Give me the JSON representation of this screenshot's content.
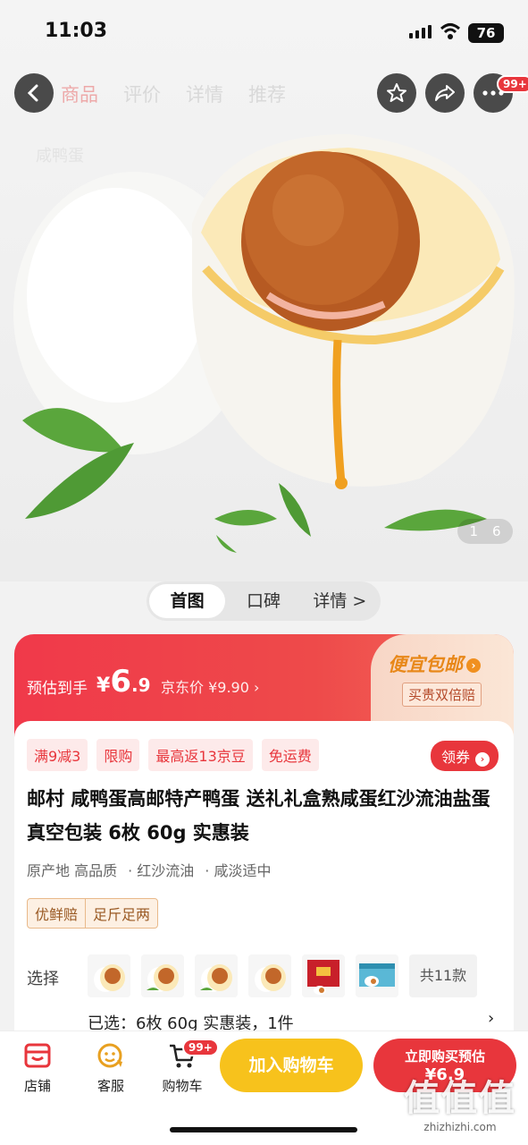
{
  "status": {
    "time": "11:03",
    "battery": "76"
  },
  "nav": {
    "tabs": [
      "商品",
      "评价",
      "详情",
      "推荐"
    ],
    "ghost_search": "咸鸭蛋",
    "more_badge": "99+"
  },
  "gallery": {
    "current": "1",
    "total": "6"
  },
  "segments": [
    "首图",
    "口碑",
    "详情 >"
  ],
  "price": {
    "estimate_label": "预估到手",
    "currency": "¥",
    "integer": "6",
    "decimal": ".9",
    "jd_price": "京东价 ¥9.90",
    "slogan": "便宜包邮",
    "guarantee": "买贵双倍赔"
  },
  "promo_tags": [
    "满9减3",
    "限购",
    "最高返13京豆",
    "免运费"
  ],
  "coupon_label": "领券",
  "product": {
    "title": "邮村 咸鸭蛋高邮特产鸭蛋 送礼礼盒熟咸蛋红沙流油盐蛋真空包装 6枚 60g 实惠装",
    "attrs": [
      "原产地 高品质",
      "· 红沙流油",
      "· 咸淡适中"
    ],
    "services": [
      "优鲜赔",
      "足斤足两"
    ]
  },
  "selection": {
    "label": "选择",
    "more": "共11款",
    "selected_text": "已选：6枚 60g 实惠装，1件"
  },
  "bottom_bar": {
    "shop": "店铺",
    "service": "客服",
    "cart": "购物车",
    "cart_badge": "99+",
    "add_to_cart": "加入购物车",
    "buy_now": "立即购买预估",
    "buy_price": "¥6.9"
  },
  "watermark": {
    "logo": "值值值",
    "url": "zhizhizhi.com"
  },
  "colors": {
    "accent": "#e8363c",
    "cart_button": "#f7c21c"
  }
}
